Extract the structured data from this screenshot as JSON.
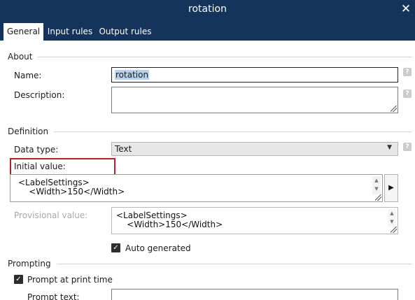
{
  "window": {
    "title": "rotation",
    "close_glyph": "✕"
  },
  "tabs": [
    {
      "label": "General",
      "active": true
    },
    {
      "label": "Input rules",
      "active": false
    },
    {
      "label": "Output rules",
      "active": false
    }
  ],
  "sections": {
    "about": "About",
    "definition": "Definition",
    "prompting": "Prompting"
  },
  "fields": {
    "name": {
      "label": "Name:",
      "value": "rotation"
    },
    "description": {
      "label": "Description:",
      "value": ""
    },
    "data_type": {
      "label": "Data type:",
      "value": "Text"
    },
    "initial_value": {
      "label": "Initial value:",
      "line1": "<LabelSettings>",
      "line2": "    <Width>150</Width>"
    },
    "provisional_value": {
      "label": "Provisional value:",
      "line1": "<LabelSettings>",
      "line2": "    <Width>150</Width>"
    },
    "auto_generated": {
      "label": "Auto generated",
      "checked": true
    },
    "prompt_at_print": {
      "label": "Prompt at print time",
      "checked": true
    },
    "prompt_text": {
      "label": "Prompt text:",
      "value": ""
    }
  },
  "glyphs": {
    "help": "?",
    "check": "✓",
    "dropdown_arrow": "▼",
    "scroll_up": "▲",
    "scroll_down": "▼",
    "play": "▶"
  },
  "colors": {
    "titlebar": "#14345c",
    "highlight_border": "#b22424",
    "selection": "#b7d2ea",
    "help_icon": "#c9cbcd"
  }
}
